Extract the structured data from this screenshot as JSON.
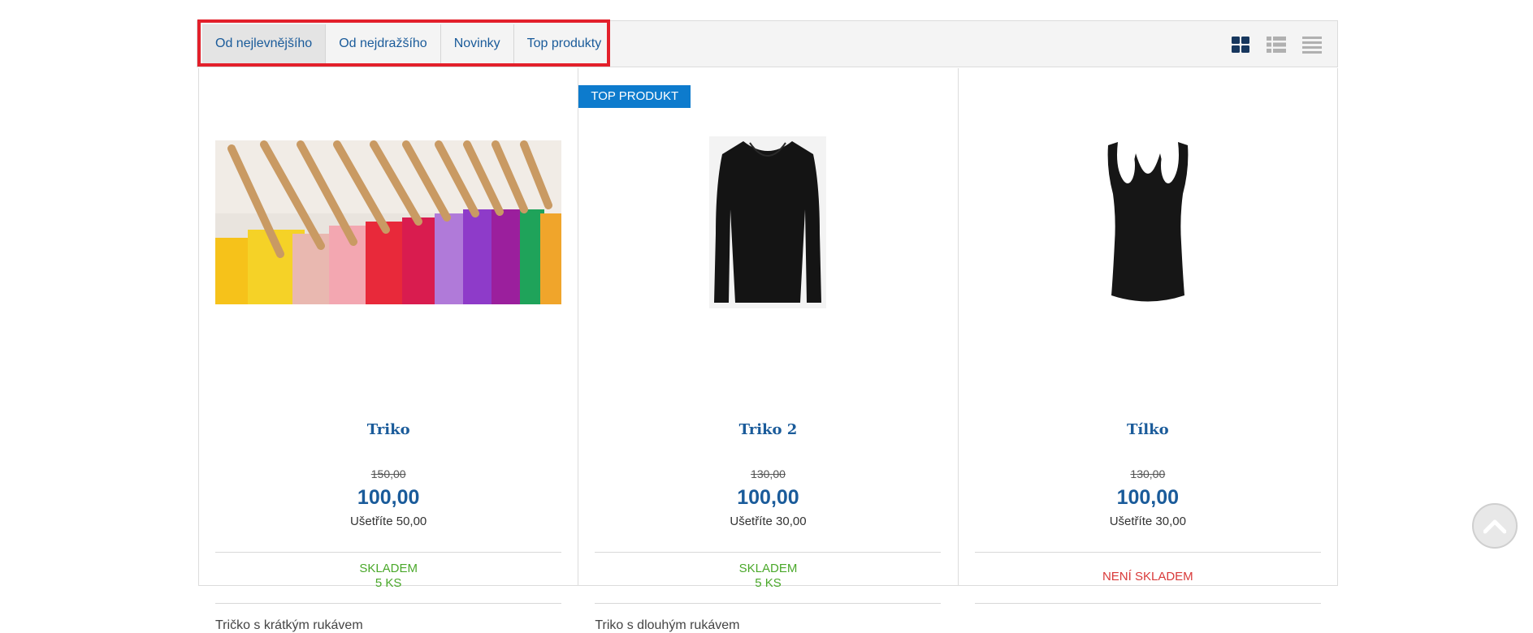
{
  "sort_tabs": [
    {
      "label": "Od nejlevnějšího",
      "active": true
    },
    {
      "label": "Od nejdražšího",
      "active": false
    },
    {
      "label": "Novinky",
      "active": false
    },
    {
      "label": "Top produkty",
      "active": false
    }
  ],
  "view_icons": [
    "grid-view-icon",
    "list-view-icon",
    "compact-list-view-icon"
  ],
  "colors": {
    "accent": "#1a5b9a",
    "badge": "#0d7bcd",
    "in_stock": "#4aa82a",
    "out_of_stock": "#d93a3a",
    "highlight": "#e3202b"
  },
  "products": [
    {
      "name": "Triko",
      "old_price": "150,00",
      "price": "100,00",
      "savings": "Ušetříte 50,00",
      "stock_status": "SKLADEM",
      "stock_count": "5 KS",
      "description": "Tričko s krátkým rukávem",
      "image": "colorful-shirts-on-hangers"
    },
    {
      "badge": "TOP PRODUKT",
      "name": "Triko 2",
      "old_price": "130,00",
      "price": "100,00",
      "savings": "Ušetříte 30,00",
      "stock_status": "SKLADEM",
      "stock_count": "5 KS",
      "description": "Triko s dlouhým rukávem",
      "image": "black-long-sleeve-shirt"
    },
    {
      "name": "Tílko",
      "old_price": "130,00",
      "price": "100,00",
      "savings": "Ušetříte 30,00",
      "stock_status": "NENÍ SKLADEM",
      "image": "black-tank-top"
    }
  ],
  "scroll_top_icon": "chevron-up-icon"
}
